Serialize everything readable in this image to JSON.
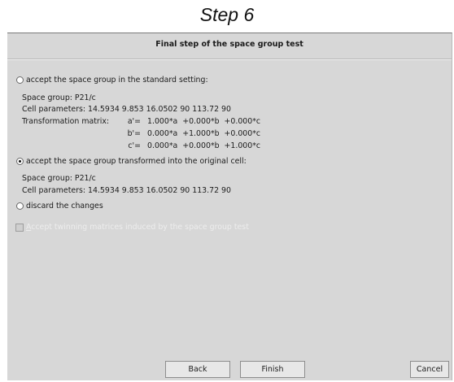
{
  "heading": "Step 6",
  "dialog": {
    "title": "Final step of the space group test",
    "option_standard": {
      "label": "accept the space group in the standard setting:",
      "selected": false,
      "space_group": "Space group: P21/c",
      "cell_parameters": "Cell parameters: 14.5934 9.853 16.0502 90 113.72 90",
      "transformation_label": "Transformation matrix:",
      "matrix": [
        {
          "name": "a'=",
          "value": "1.000*a  +0.000*b  +0.000*c"
        },
        {
          "name": "b'=",
          "value": "0.000*a  +1.000*b  +0.000*c"
        },
        {
          "name": "c'=",
          "value": "0.000*a  +0.000*b  +1.000*c"
        }
      ]
    },
    "option_original": {
      "label": "accept the space group transformed into the original cell:",
      "selected": true,
      "space_group": "Space group: P21/c",
      "cell_parameters": "Cell parameters: 14.5934 9.853 16.0502 90 113.72 90"
    },
    "option_discard": {
      "label": "discard the changes",
      "selected": false
    },
    "twinning_checkbox": {
      "first_letter": "A",
      "rest_label": "ccept twinning matrices induced by the space group test",
      "checked": false,
      "enabled": false
    },
    "buttons": {
      "back": "Back",
      "finish": "Finish",
      "cancel": "Cancel"
    }
  }
}
